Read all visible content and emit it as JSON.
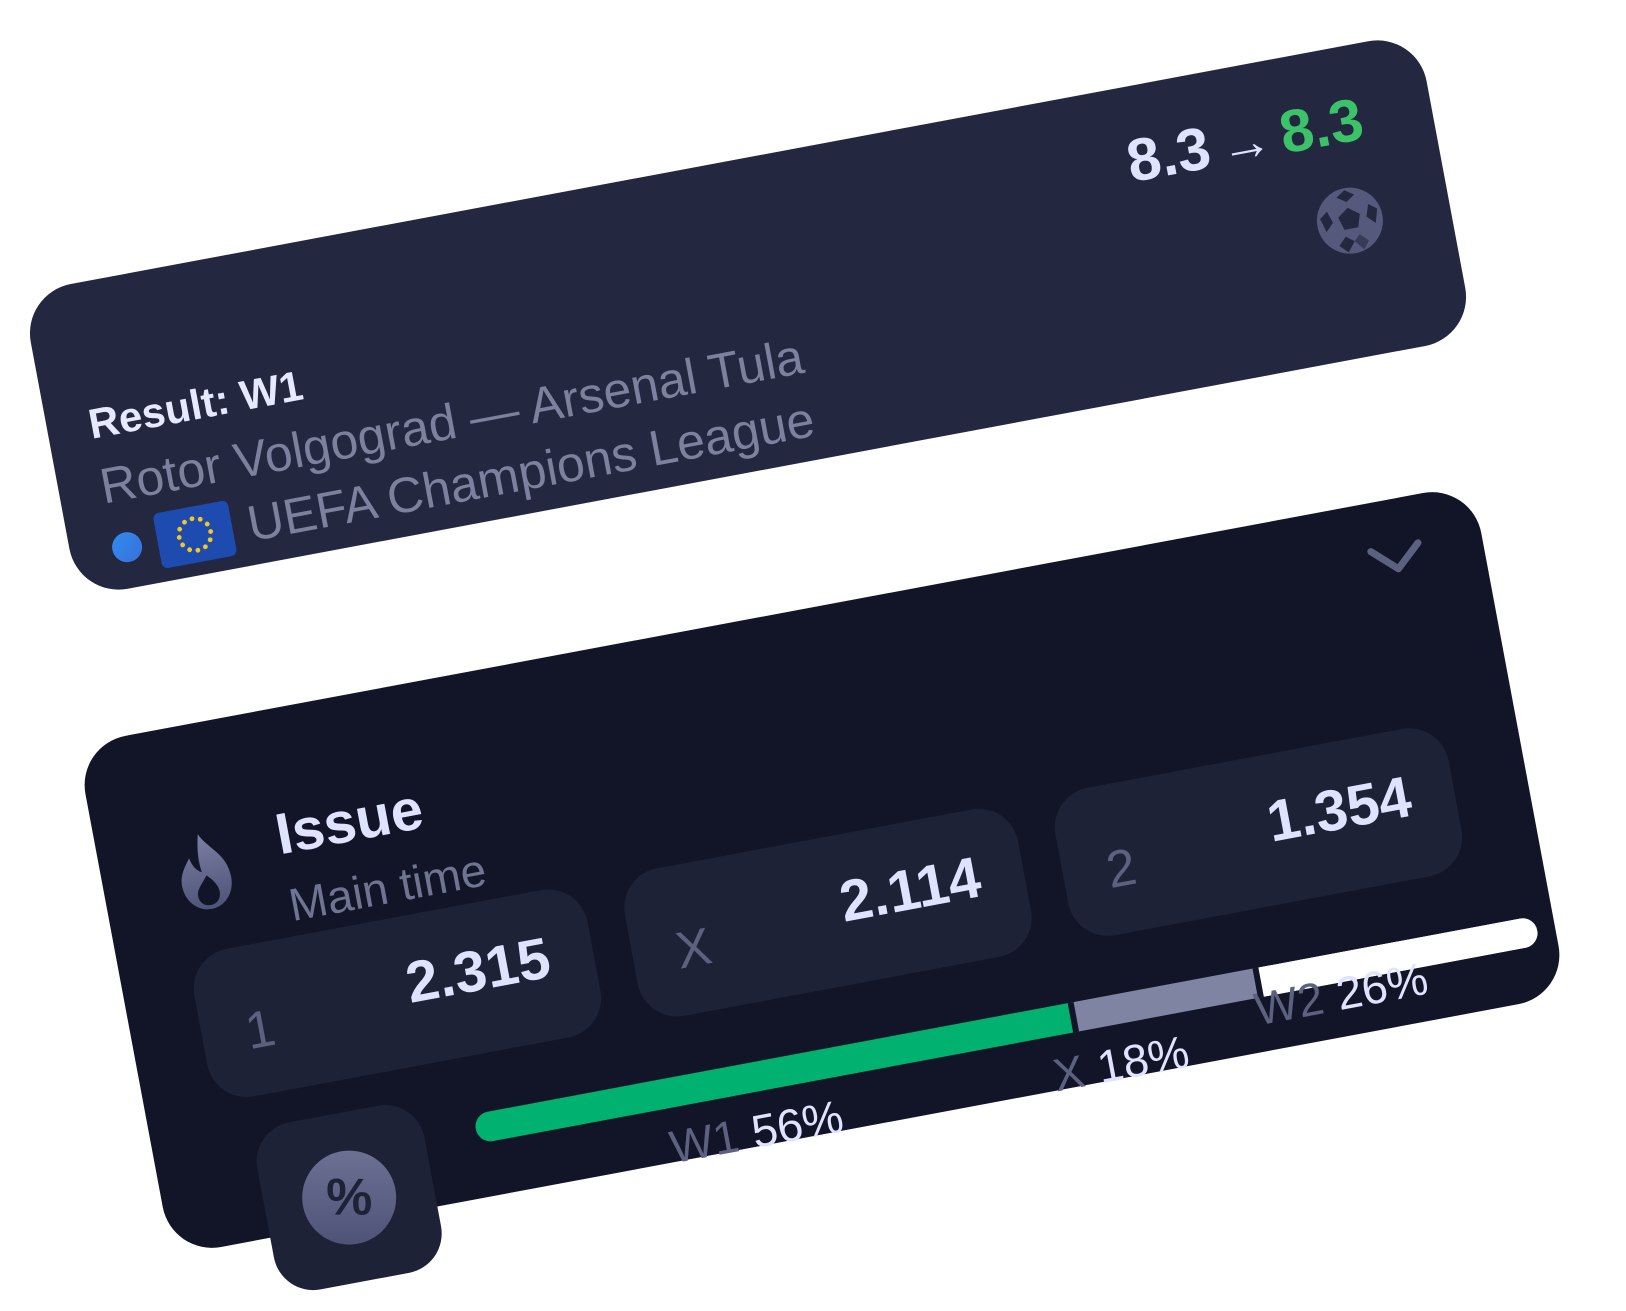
{
  "top_card": {
    "odds_old": "8.3",
    "odds_arrow": "→",
    "odds_new": "8.3",
    "result_label": "Result: W1",
    "match": "Rotor Volgograd  —  Arsenal Tula",
    "league": "UEFA Champions League",
    "icons": {
      "sport": "soccer-ball-icon",
      "live": "live-dot-icon",
      "flag": "eu-flag-icon"
    }
  },
  "bottom_card": {
    "title": "Issue",
    "subtitle": "Main time",
    "icons": {
      "header": "fire-icon",
      "collapse": "chevron-down-icon",
      "percent": "percent-icon"
    },
    "outcomes": [
      {
        "label": "1",
        "odd": "2.315"
      },
      {
        "label": "X",
        "odd": "2.114"
      },
      {
        "label": "2",
        "odd": "1.354"
      }
    ],
    "percent_symbol": "%",
    "distribution": [
      {
        "key": "W1",
        "value": "56%",
        "share": 56,
        "color": "#00b16f"
      },
      {
        "key": "X",
        "value": "18%",
        "share": 18,
        "color": "#7f84a3"
      },
      {
        "key": "W2",
        "value": "26%",
        "share": 26,
        "color": "#ffffff"
      }
    ]
  },
  "colors": {
    "top_card_bg": "#23273f",
    "bottom_card_bg": "#121527",
    "accent_green": "#3cc36a"
  }
}
